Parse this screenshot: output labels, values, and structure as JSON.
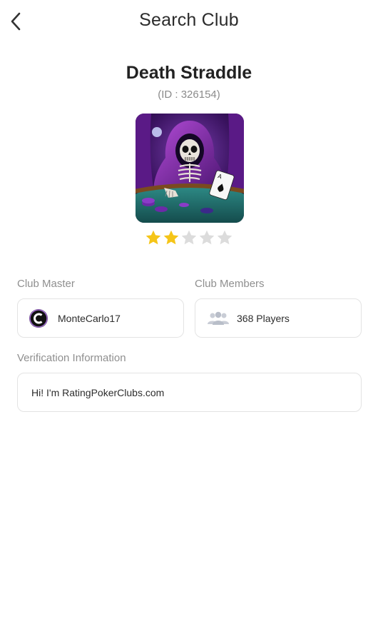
{
  "header": {
    "title": "Search Club"
  },
  "club": {
    "name": "Death Straddle",
    "id_text": "(ID : 326154)",
    "rating": 2,
    "rating_max": 5
  },
  "master": {
    "label": "Club Master",
    "name": "MonteCarlo17"
  },
  "members": {
    "label": "Club Members",
    "count_text": "368 Players"
  },
  "verification": {
    "label": "Verification Information",
    "message": "Hi! I'm RatingPokerClubs.com"
  },
  "colors": {
    "star_filled": "#f5c518",
    "star_empty": "#dcdcdc",
    "avatar_purple": "#5b2a86"
  }
}
